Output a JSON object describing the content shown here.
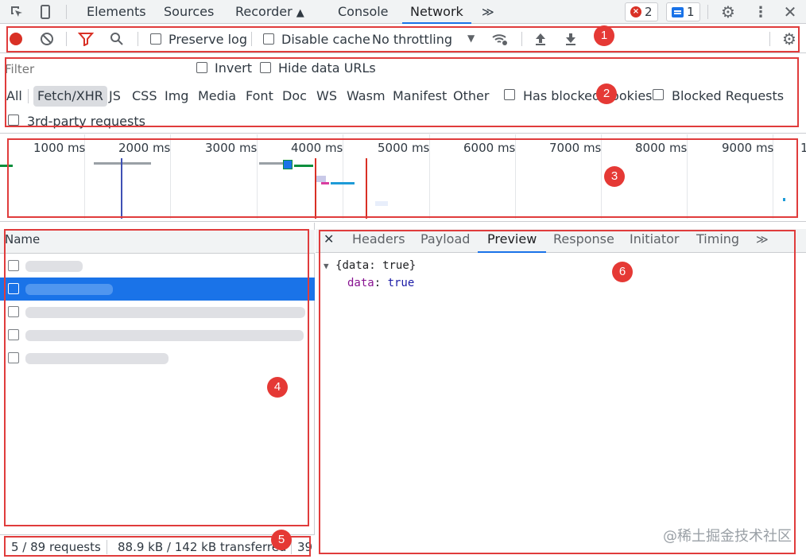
{
  "tabs": [
    "Elements",
    "Sources",
    "Recorder",
    "Console",
    "Network"
  ],
  "active_tab": "Network",
  "more_tabs": "≫",
  "error_count": "2",
  "message_count": "1",
  "toolbar": {
    "preserve_log": "Preserve log",
    "disable_cache": "Disable cache",
    "throttling": "No throttling"
  },
  "filter": {
    "placeholder": "Filter",
    "invert": "Invert",
    "hide_data_urls": "Hide data URLs",
    "types": [
      "All",
      "Fetch/XHR",
      "JS",
      "CSS",
      "Img",
      "Media",
      "Font",
      "Doc",
      "WS",
      "Wasm",
      "Manifest",
      "Other"
    ],
    "selected_type": "Fetch/XHR",
    "has_blocked_cookies": "Has blocked cookies",
    "blocked_requests": "Blocked Requests",
    "third_party": "3rd-party requests"
  },
  "overview_ticks": [
    "1000 ms",
    "2000 ms",
    "3000 ms",
    "4000 ms",
    "5000 ms",
    "6000 ms",
    "7000 ms",
    "8000 ms",
    "9000 ms",
    "1"
  ],
  "name_column": {
    "header": "Name"
  },
  "detail_tabs": [
    "Headers",
    "Payload",
    "Preview",
    "Response",
    "Initiator",
    "Timing"
  ],
  "detail_active_tab": "Preview",
  "preview": {
    "summary": "{data: true}",
    "key": "data",
    "value": "true"
  },
  "status": {
    "requests": "5 / 89 requests",
    "transferred": "88.9 kB / 142 kB transferred",
    "extra": "39"
  },
  "annotations": [
    "1",
    "2",
    "3",
    "4",
    "5",
    "6"
  ],
  "watermark": "@稀土掘金技术社区",
  "colors": {
    "accent": "#1a73e8",
    "record": "#d93025",
    "annotation": "#e03c3c"
  }
}
